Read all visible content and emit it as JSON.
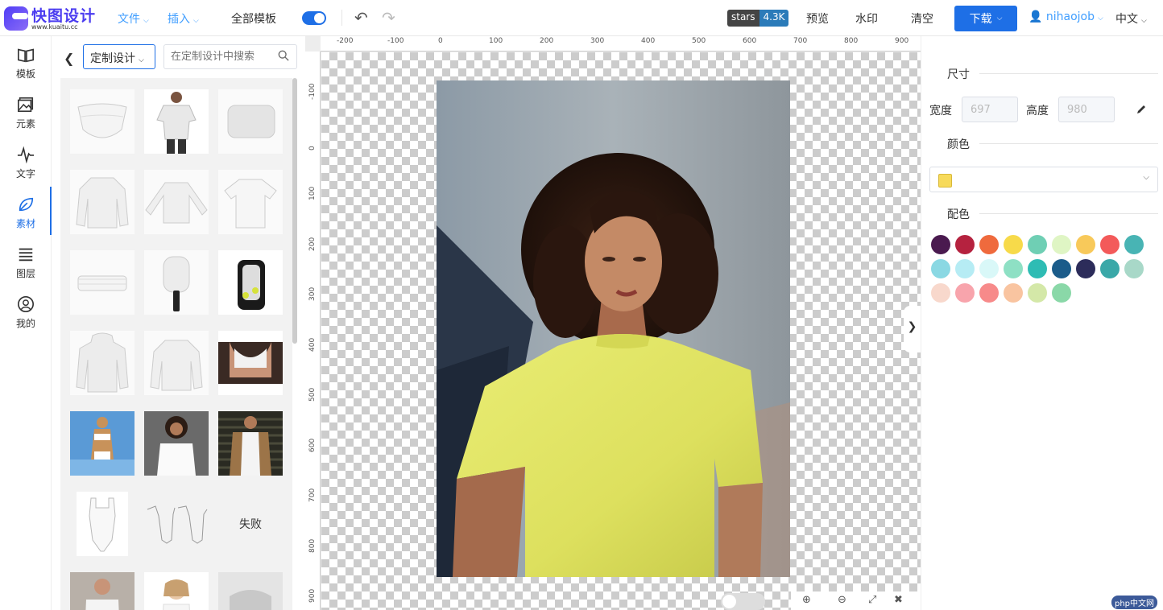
{
  "header": {
    "logo_title": "快图设计",
    "logo_url": "www.kuaitu.cc",
    "menu_file": "文件",
    "menu_insert": "插入",
    "all_templates": "全部模板",
    "stars_label": "stars",
    "stars_count": "4.3K",
    "preview": "预览",
    "watermark": "水印",
    "clear": "清空",
    "download": "下载",
    "username": "nihaojob",
    "language": "中文"
  },
  "leftnav": {
    "items": [
      {
        "label": "模板",
        "icon": "book-icon"
      },
      {
        "label": "元素",
        "icon": "image-icon"
      },
      {
        "label": "文字",
        "icon": "pulse-icon"
      },
      {
        "label": "素材",
        "icon": "leaf-icon"
      },
      {
        "label": "图层",
        "icon": "layers-icon"
      },
      {
        "label": "我的",
        "icon": "user-icon"
      }
    ],
    "active_index": 3
  },
  "panel": {
    "category": "定制设计",
    "search_placeholder": "在定制设计中搜索",
    "fail_label": "失败"
  },
  "ruler": {
    "top": [
      "-200",
      "-100",
      "0",
      "100",
      "200",
      "300",
      "400",
      "500",
      "600",
      "700",
      "800",
      "900"
    ],
    "left": [
      "-100",
      "0",
      "100",
      "200",
      "300",
      "400",
      "500",
      "600",
      "700",
      "800",
      "900"
    ]
  },
  "rightpanel": {
    "size_title": "尺寸",
    "width_label": "宽度",
    "width_value": "697",
    "height_label": "高度",
    "height_value": "980",
    "color_title": "颜色",
    "selected_color": "#f7da5a",
    "palette_title": "配色",
    "palette": [
      "#4a1a4f",
      "#b5223f",
      "#ef6a3d",
      "#f7da4a",
      "#6fcfb4",
      "#dff5c4",
      "#f8c95a",
      "#f35a5a",
      "#48b4b4",
      "#8ad8e3",
      "#b6ecf4",
      "#d9f8f8",
      "#8ee0c4",
      "#2ebcb4",
      "#1b5c8a",
      "#2c2c5a",
      "#3aa8a8",
      "#a8d8c8",
      "#f8d8cc",
      "#f8a4ac",
      "#f78a8a",
      "#f9c4a0",
      "#d4e8a8",
      "#8ad8a8"
    ]
  },
  "footer": {
    "site_badge": "php中文网"
  }
}
